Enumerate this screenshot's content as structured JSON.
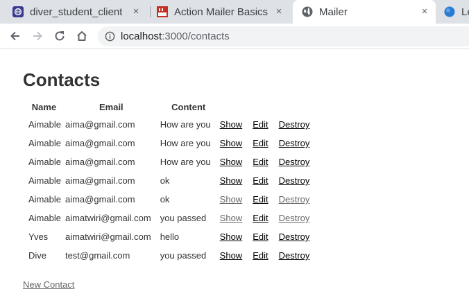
{
  "browser": {
    "tabs": [
      {
        "title": "diver_student_client",
        "icon": "globe-icon"
      },
      {
        "title": "Action Mailer Basics",
        "icon": "rails-guides-icon"
      },
      {
        "title": "Mailer",
        "icon": "globe-icon",
        "active": true
      },
      {
        "title": "Le",
        "icon": "blue-circle-icon"
      }
    ],
    "close_glyph": "×",
    "url_host": "localhost",
    "url_rest": ":3000/contacts"
  },
  "page": {
    "heading": "Contacts",
    "columns": {
      "name": "Name",
      "email": "Email",
      "content": "Content"
    },
    "rows": [
      {
        "name": "Aimable",
        "email": "aima@gmail.com",
        "content": "How are you",
        "show": "Show",
        "edit": "Edit",
        "destroy": "Destroy",
        "visited": false
      },
      {
        "name": "Aimable",
        "email": "aima@gmail.com",
        "content": "How are you",
        "show": "Show",
        "edit": "Edit",
        "destroy": "Destroy",
        "visited": false
      },
      {
        "name": "Aimable",
        "email": "aima@gmail.com",
        "content": "How are you",
        "show": "Show",
        "edit": "Edit",
        "destroy": "Destroy",
        "visited": false
      },
      {
        "name": "Aimable",
        "email": "aima@gmail.com",
        "content": "ok",
        "show": "Show",
        "edit": "Edit",
        "destroy": "Destroy",
        "visited": false
      },
      {
        "name": "Aimable",
        "email": "aima@gmail.com",
        "content": "ok",
        "show": "Show",
        "edit": "Edit",
        "destroy": "Destroy",
        "visited": true
      },
      {
        "name": "Aimable",
        "email": "aimatwiri@gmail.com",
        "content": "you passed",
        "show": "Show",
        "edit": "Edit",
        "destroy": "Destroy",
        "visited": true
      },
      {
        "name": "Yves",
        "email": "aimatwiri@gmail.com",
        "content": "hello",
        "show": "Show",
        "edit": "Edit",
        "destroy": "Destroy",
        "visited": false
      },
      {
        "name": "Dive",
        "email": "test@gmail.com",
        "content": "you passed",
        "show": "Show",
        "edit": "Edit",
        "destroy": "Destroy",
        "visited": false
      }
    ],
    "new_contact_label": "New Contact"
  }
}
